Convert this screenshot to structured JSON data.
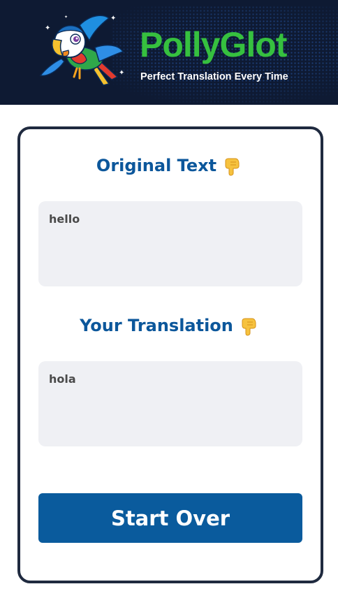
{
  "header": {
    "logo_title": "PollyGlot",
    "tagline": "Perfect Translation Every Time",
    "mascot_icon": "parrot-icon",
    "colors": {
      "background": "#0e1a33",
      "title": "#36c03f"
    }
  },
  "original": {
    "heading": "Original Text",
    "heading_icon": "pointing-down-hand-icon",
    "value": "hello"
  },
  "translation": {
    "heading": "Your Translation",
    "heading_icon": "pointing-down-hand-icon",
    "value": "hola"
  },
  "actions": {
    "start_over_label": "Start Over"
  },
  "colors": {
    "accent": "#0a5b9d",
    "heading": "#0c579b",
    "field_bg": "#eff0f4"
  }
}
